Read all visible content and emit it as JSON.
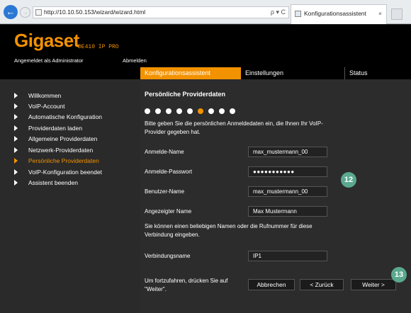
{
  "browser": {
    "url": "http://10.10.50.153/wizard/wizard.html",
    "tab_title": "Konfigurationsassistent",
    "back_icon": "←",
    "forward_icon": "→",
    "address_tools": "ρ ▾ C",
    "tab_close": "×"
  },
  "header": {
    "logo": "Gigaset",
    "model": "DE410 IP PRO",
    "logged_in": "Angemeldet als Administrator",
    "logout": "Abmelden",
    "brand_color": "#f39200"
  },
  "nav": {
    "tabs": [
      {
        "label": "Konfigurationsassistent",
        "active": true
      },
      {
        "label": "Einstellungen",
        "active": false
      },
      {
        "label": "Status",
        "active": false
      }
    ]
  },
  "sidebar": {
    "items": [
      {
        "label": "Willkommen",
        "active": false
      },
      {
        "label": "VoIP-Account",
        "active": false
      },
      {
        "label": "Automatische Konfiguration",
        "active": false
      },
      {
        "label": "Providerdaten laden",
        "active": false
      },
      {
        "label": "Allgemeine Providerdaten",
        "active": false
      },
      {
        "label": "Netzwerk-Providerdaten",
        "active": false
      },
      {
        "label": "Persönliche Providerdaten",
        "active": true
      },
      {
        "label": "VoIP-Konfiguration beendet",
        "active": false
      },
      {
        "label": "Assistent beenden",
        "active": false
      }
    ]
  },
  "main": {
    "title": "Persönliche Providerdaten",
    "progress": {
      "total": 9,
      "current": 6
    },
    "intro": "Bitte geben Sie die persönlichen Anmeldedaten ein, die Ihnen Ihr VoIP-Provider gegeben hat.",
    "fields": [
      {
        "label": "Anmelde-Name",
        "value": "max_mustermann_00"
      },
      {
        "label": "Anmelde-Passwort",
        "value": "●●●●●●●●●●●"
      },
      {
        "label": "Benutzer-Name",
        "value": "max_mustermann_00"
      },
      {
        "label": "Angezeigter Name",
        "value": "Max Mustermann"
      }
    ],
    "hint": "Sie können einen beliebigen Namen oder die Rufnummer für diese Verbindung eingeben.",
    "connection_label": "Verbindungsname",
    "connection_value": "IP1",
    "continue_text": "Um fortzufahren, drücken Sie auf \"Weiter\".",
    "buttons": {
      "cancel": "Abbrechen",
      "back": "< Zurück",
      "next": "Weiter >"
    },
    "badges": [
      "12",
      "13"
    ]
  }
}
